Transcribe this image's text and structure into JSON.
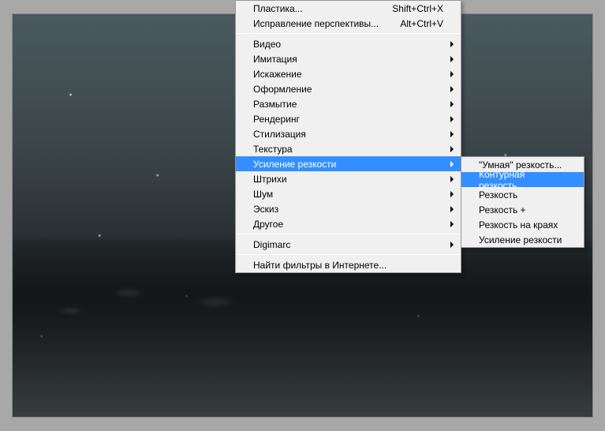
{
  "menu": {
    "items": [
      {
        "label": "Пластика...",
        "shortcut": "Shift+Ctrl+X"
      },
      {
        "label": "Исправление перспективы...",
        "shortcut": "Alt+Ctrl+V"
      }
    ],
    "group2": [
      {
        "label": "Видео"
      },
      {
        "label": "Имитация"
      },
      {
        "label": "Искажение"
      },
      {
        "label": "Оформление"
      },
      {
        "label": "Размытие"
      },
      {
        "label": "Рендеринг"
      },
      {
        "label": "Стилизация"
      },
      {
        "label": "Текстура"
      },
      {
        "label": "Усиление резкости",
        "selected": true
      },
      {
        "label": "Штрихи"
      },
      {
        "label": "Шум"
      },
      {
        "label": "Эскиз"
      },
      {
        "label": "Другое"
      }
    ],
    "group3": [
      {
        "label": "Digimarc"
      }
    ],
    "group4": [
      {
        "label": "Найти фильтры в Интернете..."
      }
    ]
  },
  "submenu": {
    "items": [
      {
        "label": "\"Умная\" резкость..."
      },
      {
        "label": "Контурная резкость...",
        "selected": true
      },
      {
        "label": "Резкость"
      },
      {
        "label": "Резкость +"
      },
      {
        "label": "Резкость на краях"
      },
      {
        "label": "Усиление резкости"
      }
    ]
  }
}
